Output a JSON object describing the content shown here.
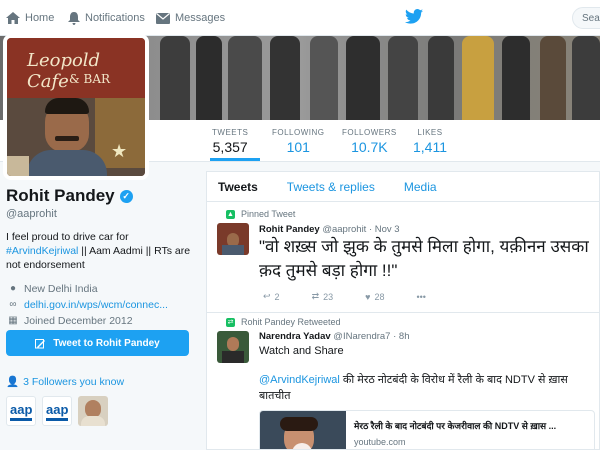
{
  "nav": {
    "home": "Home",
    "notifications": "Notifications",
    "messages": "Messages",
    "search_placeholder": "Sear"
  },
  "stats": [
    {
      "label": "TWEETS",
      "value": "5,357"
    },
    {
      "label": "FOLLOWING",
      "value": "101"
    },
    {
      "label": "FOLLOWERS",
      "value": "10.7K"
    },
    {
      "label": "LIKES",
      "value": "1,411"
    }
  ],
  "banner_text": [
    "Leopold Cafe",
    "& BAR"
  ],
  "profile": {
    "name": "Rohit Pandey",
    "handle": "@aaprohit",
    "bio_line1": "I feel proud to drive car for",
    "bio_mention": "#ArvindKejriwal",
    "bio_line2": " || Aam Aadmi || RTs are not endorsement",
    "location": "New Delhi India",
    "website": "delhi.gov.in/wps/wcm/connec...",
    "joined": "Joined December 2012",
    "tweet_to_button": "Tweet to Rohit Pandey",
    "followers_you_know": "3 Followers you know",
    "follower_logo_text": "aap"
  },
  "tabs": [
    "Tweets",
    "Tweets & replies",
    "Media"
  ],
  "tweets": [
    {
      "context": "Pinned Tweet",
      "name": "Rohit Pandey",
      "handle": "@aaprohit",
      "time": "· Nov 3",
      "text": "\"वो शख़्स जो झुक के तुमसे मिला होगा, यक़ीनन उसका क़द तुमसे बड़ा होगा !!\"",
      "retweets": "23",
      "likes": "28",
      "replies": "2"
    },
    {
      "context": "Rohit Pandey Retweeted",
      "name": "Narendra Yadav",
      "handle": "@INarendra7",
      "time": "· 8h",
      "text": "Watch and Share",
      "mention": "@ArvindKejriwal",
      "text2": " की मेरठ नोटबंदी के विरोध में रैली के बाद NDTV से ख़ास बातचीत",
      "card_title": "मेरठ रैली के बाद नोटबंदी पर केजरीवाल की NDTV से ख़ास ...",
      "card_domain": "youtube.com"
    }
  ],
  "colors": {
    "accent": "#1da1f2",
    "link": "#1b95e0",
    "muted": "#66757f"
  }
}
